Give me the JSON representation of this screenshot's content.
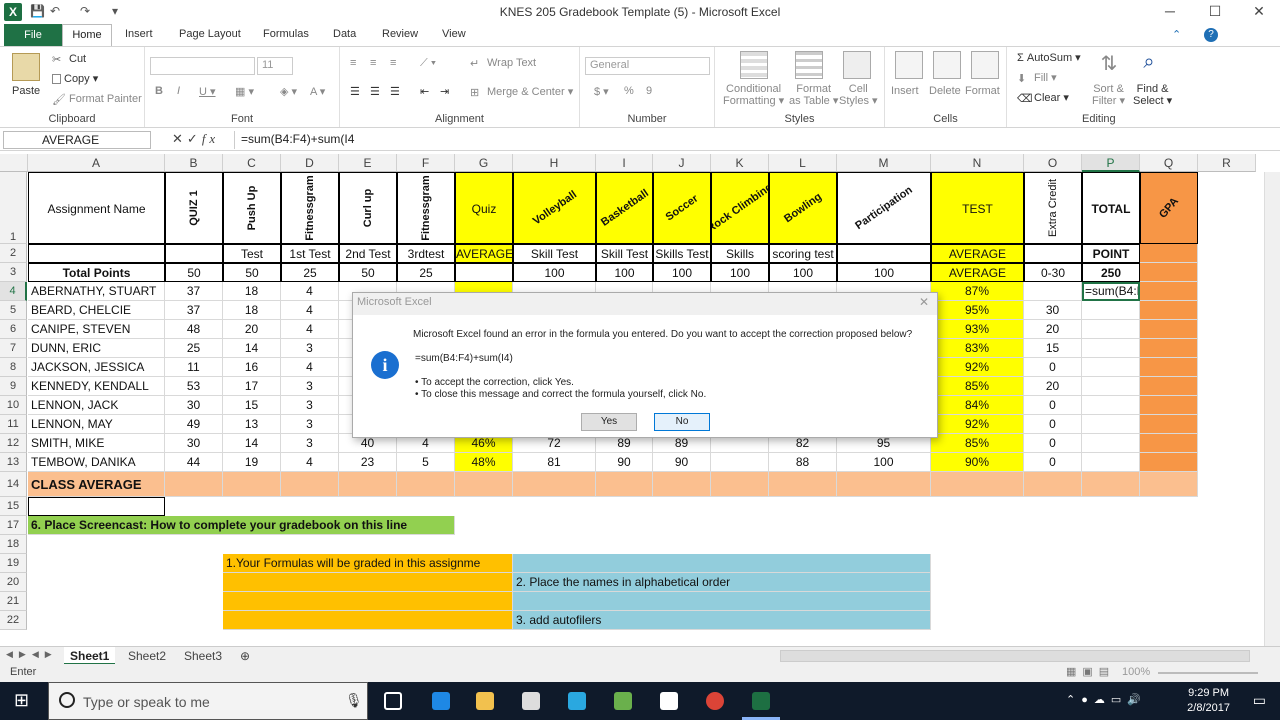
{
  "window": {
    "title": "KNES 205 Gradebook Template  (5)  -  Microsoft Excel",
    "min": "─",
    "restore": "☐",
    "close": "✕",
    "help": "?"
  },
  "tabs": [
    "File",
    "Home",
    "Insert",
    "Page Layout",
    "Formulas",
    "Data",
    "Review",
    "View"
  ],
  "ribbon": {
    "clipboard": {
      "label": "Clipboard",
      "paste": "Paste",
      "cut": "Cut",
      "copy": "Copy ▾",
      "format_painter": "Format Painter"
    },
    "font": {
      "label": "Font",
      "size": "11",
      "bold": "B",
      "italic": "I",
      "underline": "U ▾"
    },
    "alignment": {
      "label": "Alignment",
      "wrap": "Wrap Text",
      "merge": "Merge & Center ▾"
    },
    "number": {
      "label": "Number",
      "format": "General",
      "currency": "$ ▾",
      "percent": "%",
      "comma": "9"
    },
    "styles": {
      "label": "Styles",
      "conditional": "Conditional\nFormatting ▾",
      "table": "Format\nas Table ▾",
      "cell": "Cell\nStyles ▾"
    },
    "cells": {
      "label": "Cells",
      "insert": "Insert",
      "delete": "Delete",
      "format": "Format"
    },
    "editing": {
      "label": "Editing",
      "autosum": "Σ AutoSum ▾",
      "fill": "Fill ▾",
      "clear": "Clear ▾",
      "sort": "Sort &\nFilter ▾",
      "find": "Find &\nSelect ▾"
    }
  },
  "formula_bar": {
    "name_box": "AVERAGE",
    "fx": "fx",
    "formula": "=sum(B4:F4)+sum(I4"
  },
  "columns": [
    {
      "name": "A",
      "width": 137
    },
    {
      "name": "B",
      "width": 58
    },
    {
      "name": "C",
      "width": 58
    },
    {
      "name": "D",
      "width": 58
    },
    {
      "name": "E",
      "width": 58
    },
    {
      "name": "F",
      "width": 58
    },
    {
      "name": "G",
      "width": 58
    },
    {
      "name": "H",
      "width": 83
    },
    {
      "name": "I",
      "width": 57
    },
    {
      "name": "J",
      "width": 58
    },
    {
      "name": "K",
      "width": 58
    },
    {
      "name": "L",
      "width": 68
    },
    {
      "name": "M",
      "width": 94
    },
    {
      "name": "N",
      "width": 93
    },
    {
      "name": "O",
      "width": 58
    },
    {
      "name": "P",
      "width": 58
    },
    {
      "name": "Q",
      "width": 58
    },
    {
      "name": "R",
      "width": 58
    }
  ],
  "rows": [
    "1",
    "2",
    "3",
    "4",
    "5",
    "6",
    "7",
    "8",
    "9",
    "10",
    "11",
    "12",
    "13",
    "14",
    "15",
    "17",
    "18",
    "19",
    "20",
    "21",
    "22"
  ],
  "header": {
    "assignment_name": "Assignment Name",
    "b1": "QUIZ 1",
    "c1": "Push Up",
    "d1": "Fitnessgram",
    "e1": "Curl up",
    "f1": "Fitnessgram",
    "g1": "Quiz",
    "h1": "Volleyball",
    "i1": "Basketball",
    "j1": "Soccer",
    "k1": "Rock Climbing",
    "l1": "Bowling",
    "m1": "Participation",
    "n1": "TEST",
    "o1": "Extra Credit",
    "p1": "TOTAL",
    "q1": "GPA",
    "row2": [
      "",
      "",
      "Test",
      "1st Test",
      "2nd Test",
      "3rdtest",
      "AVERAGE",
      "Skill Test",
      "Skill Test",
      "Skills Test",
      "Skills",
      "scoring test",
      "",
      "AVERAGE",
      "",
      "POINT",
      ""
    ],
    "row3": [
      "Total Points",
      "50",
      "50",
      "25",
      "50",
      "25",
      "",
      "100",
      "100",
      "100",
      "100",
      "100",
      "100",
      "AVERAGE",
      "0-30",
      "250",
      ""
    ]
  },
  "students": [
    {
      "name": "ABERNATHY, STUART",
      "b": "37",
      "c": "18",
      "d": "4",
      "n": "87%",
      "o": "",
      "p": "=sum(B4:F4)+sum(I4"
    },
    {
      "name": "BEARD, CHELCIE",
      "b": "37",
      "c": "18",
      "d": "4",
      "n": "95%",
      "o": "30"
    },
    {
      "name": "CANIPE, STEVEN",
      "b": "48",
      "c": "20",
      "d": "4",
      "n": "93%",
      "o": "20"
    },
    {
      "name": "DUNN, ERIC",
      "b": "25",
      "c": "14",
      "d": "3",
      "n": "83%",
      "o": "15"
    },
    {
      "name": "JACKSON, JESSICA",
      "b": "11",
      "c": "16",
      "d": "4",
      "n": "92%",
      "o": "0"
    },
    {
      "name": "KENNEDY, KENDALL",
      "b": "53",
      "c": "17",
      "d": "3",
      "n": "85%",
      "o": "20"
    },
    {
      "name": "LENNON, JACK",
      "b": "30",
      "c": "15",
      "d": "3",
      "n": "84%",
      "o": "0"
    },
    {
      "name": "LENNON, MAY",
      "b": "49",
      "c": "13",
      "d": "3",
      "n": "92%",
      "o": "0"
    },
    {
      "name": "SMITH, MIKE",
      "b": "30",
      "c": "14",
      "d": "3",
      "e": "40",
      "f": "4",
      "g": "46%",
      "h": "72",
      "i": "89",
      "j": "89",
      "l": "82",
      "m": "95",
      "n": "85%",
      "o": "0"
    },
    {
      "name": "TEMBOW, DANIKA",
      "b": "44",
      "c": "19",
      "d": "4",
      "e": "23",
      "f": "5",
      "g": "48%",
      "h": "81",
      "i": "90",
      "j": "90",
      "l": "88",
      "m": "100",
      "n": "90%",
      "o": "0"
    }
  ],
  "class_average": "CLASS AVERAGE",
  "notes": {
    "screencast": "6. Place Screencast: How to complete your gradebook on this line",
    "formulas": "1.Your Formulas will be graded in this assignme",
    "alphabetical": "2. Place the names in alphabetical order",
    "autofilters": "3. add autofilers"
  },
  "dialog": {
    "title": "Microsoft Excel",
    "message": "Microsoft Excel found an error in the formula you entered. Do you want to accept the correction proposed below?",
    "proposed": "=sum(B4:F4)+sum(I4)",
    "bullet1": "• To accept the correction, click Yes.",
    "bullet2": "• To close this message and correct the formula yourself, click No.",
    "yes": "Yes",
    "no": "No"
  },
  "sheets": [
    "Sheet1",
    "Sheet2",
    "Sheet3"
  ],
  "status": {
    "mode": "Enter",
    "zoom": "100%"
  },
  "taskbar": {
    "search_placeholder": "Type or speak to me",
    "time": "9:29 PM",
    "date": "2/8/2017"
  },
  "colors": {
    "excel_green": "#217346",
    "quiz_yellow": "#ffff00",
    "gpa_orange": "#f79646",
    "class_avg": "#fbbf8f"
  }
}
